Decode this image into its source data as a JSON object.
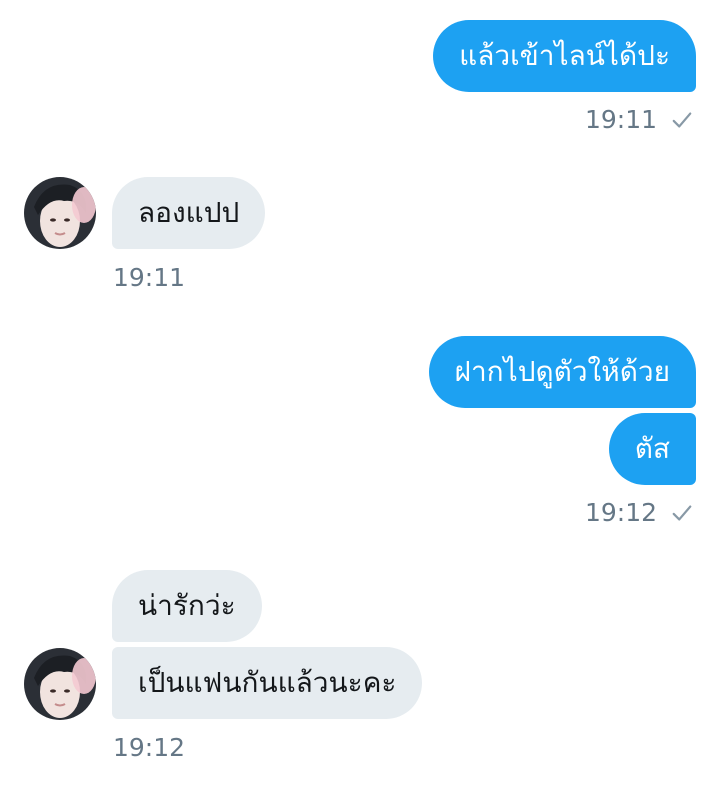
{
  "messages": [
    {
      "side": "out",
      "text": "แล้วเข้าไลน์ได้ปะ"
    },
    {
      "side": "in",
      "text": "ลองแปป"
    },
    {
      "side": "out",
      "text": "ฝากไปดูตัวให้ด้วย"
    },
    {
      "side": "out",
      "text": "ตัส"
    },
    {
      "side": "in",
      "text": "น่ารักว่ะ"
    },
    {
      "side": "in",
      "text": "เป็นแฟนกันแล้วนะคะ"
    }
  ],
  "timestamps": {
    "t1": "19:11",
    "t2": "19:11",
    "t3": "19:12",
    "t4": "19:12"
  },
  "icons": {
    "read_receipt": "check-icon",
    "sender": "avatar"
  },
  "colors": {
    "outgoing_bubble": "#1da1f2",
    "incoming_bubble": "#e6ecf0",
    "timestamp": "#657786"
  }
}
